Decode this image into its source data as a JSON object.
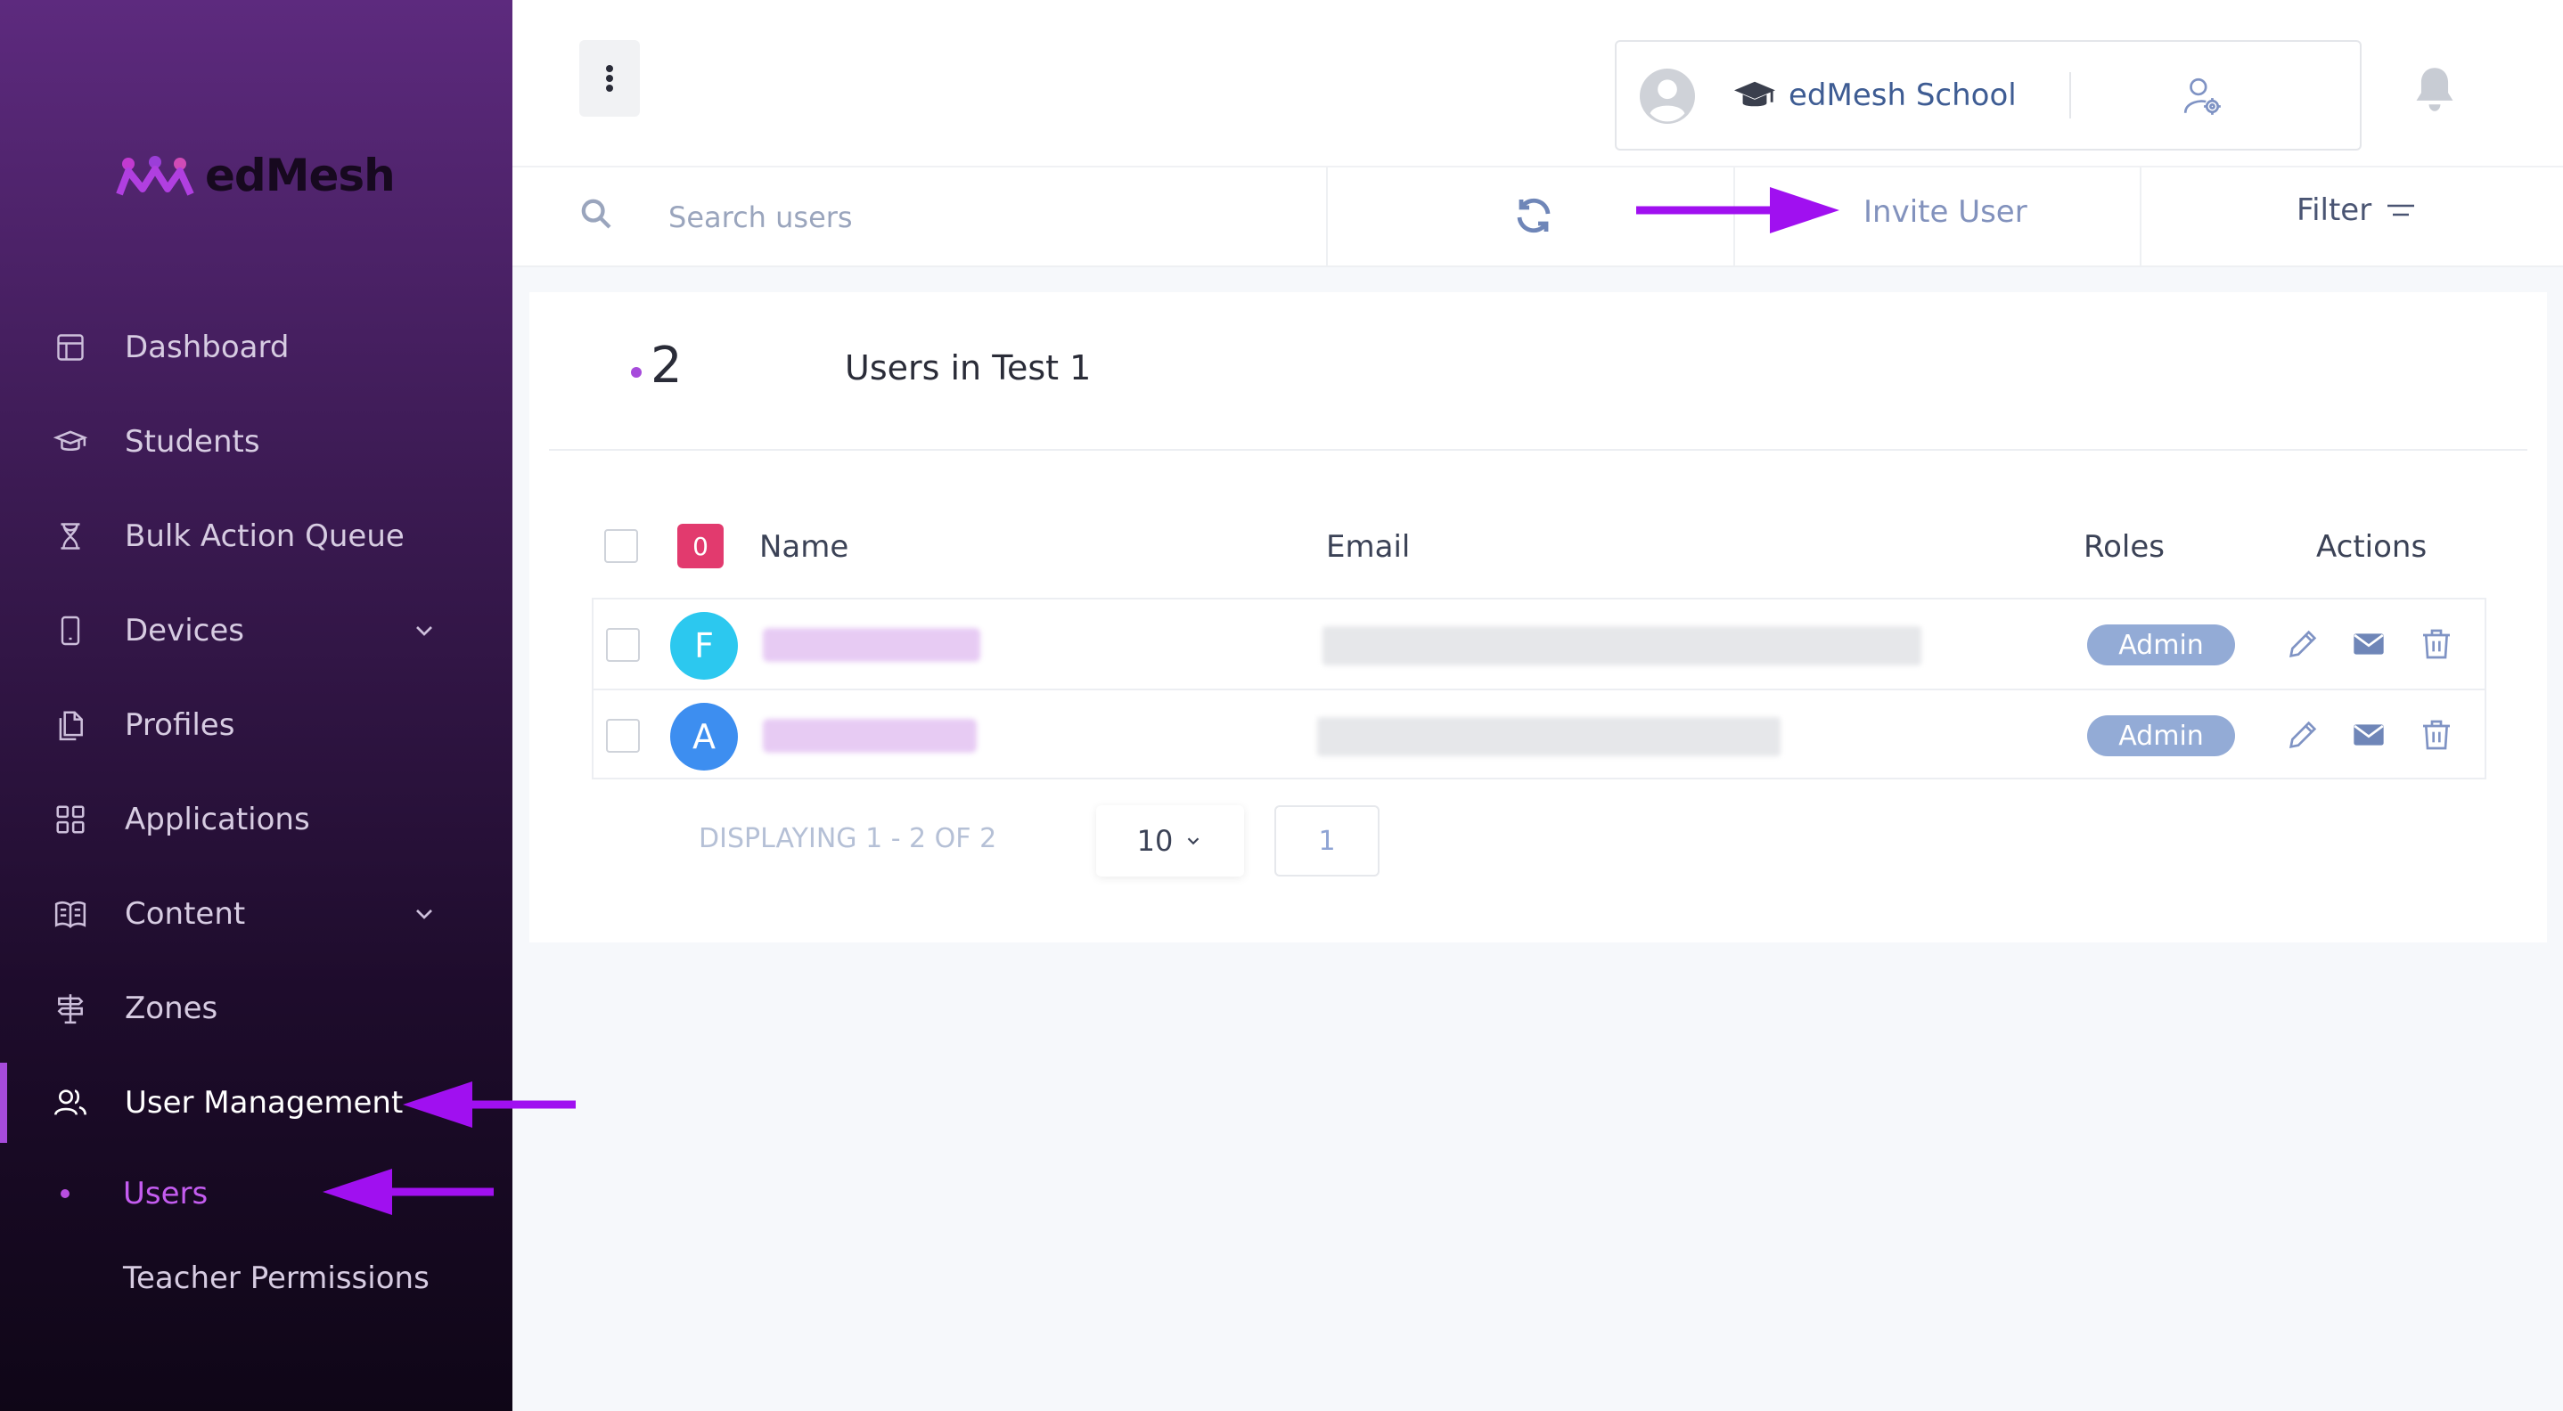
{
  "brand": {
    "name": "edMesh"
  },
  "sidebar": {
    "items": [
      {
        "label": "Dashboard",
        "icon": "dashboard-icon"
      },
      {
        "label": "Students",
        "icon": "graduation-cap-icon"
      },
      {
        "label": "Bulk Action Queue",
        "icon": "hourglass-icon"
      },
      {
        "label": "Devices",
        "icon": "phone-icon",
        "expandable": true
      },
      {
        "label": "Profiles",
        "icon": "documents-icon"
      },
      {
        "label": "Applications",
        "icon": "grid-icon"
      },
      {
        "label": "Content",
        "icon": "book-icon",
        "expandable": true
      },
      {
        "label": "Zones",
        "icon": "signpost-icon"
      },
      {
        "label": "User Management",
        "icon": "users-icon",
        "active": true
      }
    ],
    "subitems": [
      {
        "label": "Users",
        "current": true
      },
      {
        "label": "Teacher Permissions",
        "current": false
      }
    ]
  },
  "topbar": {
    "school_name": "edMesh School"
  },
  "toolbar": {
    "search_placeholder": "Search users",
    "invite_label": "Invite User",
    "filter_label": "Filter"
  },
  "card": {
    "count": "2",
    "title": "Users in Test 1",
    "selected_count": "0",
    "columns": {
      "name": "Name",
      "email": "Email",
      "roles": "Roles",
      "actions": "Actions"
    },
    "rows": [
      {
        "initial": "F",
        "avatar_color": "#2cc8ef",
        "role": "Admin"
      },
      {
        "initial": "A",
        "avatar_color": "#3d8ef0",
        "role": "Admin"
      }
    ],
    "displaying": "DISPLAYING 1 - 2 OF 2",
    "page_size": "10",
    "page": "1"
  },
  "colors": {
    "accent": "#a64bdb",
    "annotation_arrow": "#a010f0",
    "role_badge": "#93abd6"
  }
}
